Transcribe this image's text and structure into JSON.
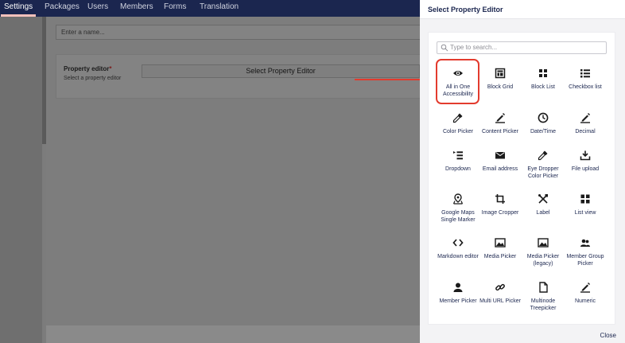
{
  "nav": {
    "tabs": [
      "Settings",
      "Packages",
      "Users",
      "Members",
      "Forms",
      "Translation"
    ]
  },
  "background_page": {
    "name_placeholder": "Enter a name...",
    "property_editor_label": "Property editor",
    "required_mark": "*",
    "property_editor_description": "Select a property editor",
    "select_button_label": "Select Property Editor"
  },
  "modal": {
    "title": "Select Property Editor",
    "search_placeholder": "Type to search...",
    "close_label": "Close",
    "editors": [
      {
        "label": "All in One Accessibility",
        "icon": "eye-icon",
        "highlighted": true
      },
      {
        "label": "Block Grid",
        "icon": "block-grid-icon"
      },
      {
        "label": "Block List",
        "icon": "block-list-icon"
      },
      {
        "label": "Checkbox list",
        "icon": "checkbox-list-icon"
      },
      {
        "label": "Color Picker",
        "icon": "eyedropper-icon"
      },
      {
        "label": "Content Picker",
        "icon": "picker-icon"
      },
      {
        "label": "Date/Time",
        "icon": "clock-icon"
      },
      {
        "label": "Decimal",
        "icon": "picker-icon"
      },
      {
        "label": "Dropdown",
        "icon": "dropdown-icon"
      },
      {
        "label": "Email address",
        "icon": "envelope-icon"
      },
      {
        "label": "Eye Dropper Color Picker",
        "icon": "eyedropper-icon"
      },
      {
        "label": "File upload",
        "icon": "upload-icon"
      },
      {
        "label": "Google Maps Single Marker",
        "icon": "map-marker-icon"
      },
      {
        "label": "Image Cropper",
        "icon": "crop-icon"
      },
      {
        "label": "Label",
        "icon": "tools-icon"
      },
      {
        "label": "List view",
        "icon": "list-view-icon"
      },
      {
        "label": "Markdown editor",
        "icon": "code-icon"
      },
      {
        "label": "Media Picker",
        "icon": "image-icon"
      },
      {
        "label": "Media Picker (legacy)",
        "icon": "image-icon"
      },
      {
        "label": "Member Group Picker",
        "icon": "users-icon"
      },
      {
        "label": "Member Picker",
        "icon": "user-icon"
      },
      {
        "label": "Multi URL Picker",
        "icon": "link-icon"
      },
      {
        "label": "Multinode Treepicker",
        "icon": "document-icon"
      },
      {
        "label": "Numeric",
        "icon": "picker-icon"
      }
    ]
  },
  "colors": {
    "nav_background": "#1b264f",
    "highlight_red": "#e33b2e",
    "text_dark": "#1b264f"
  }
}
